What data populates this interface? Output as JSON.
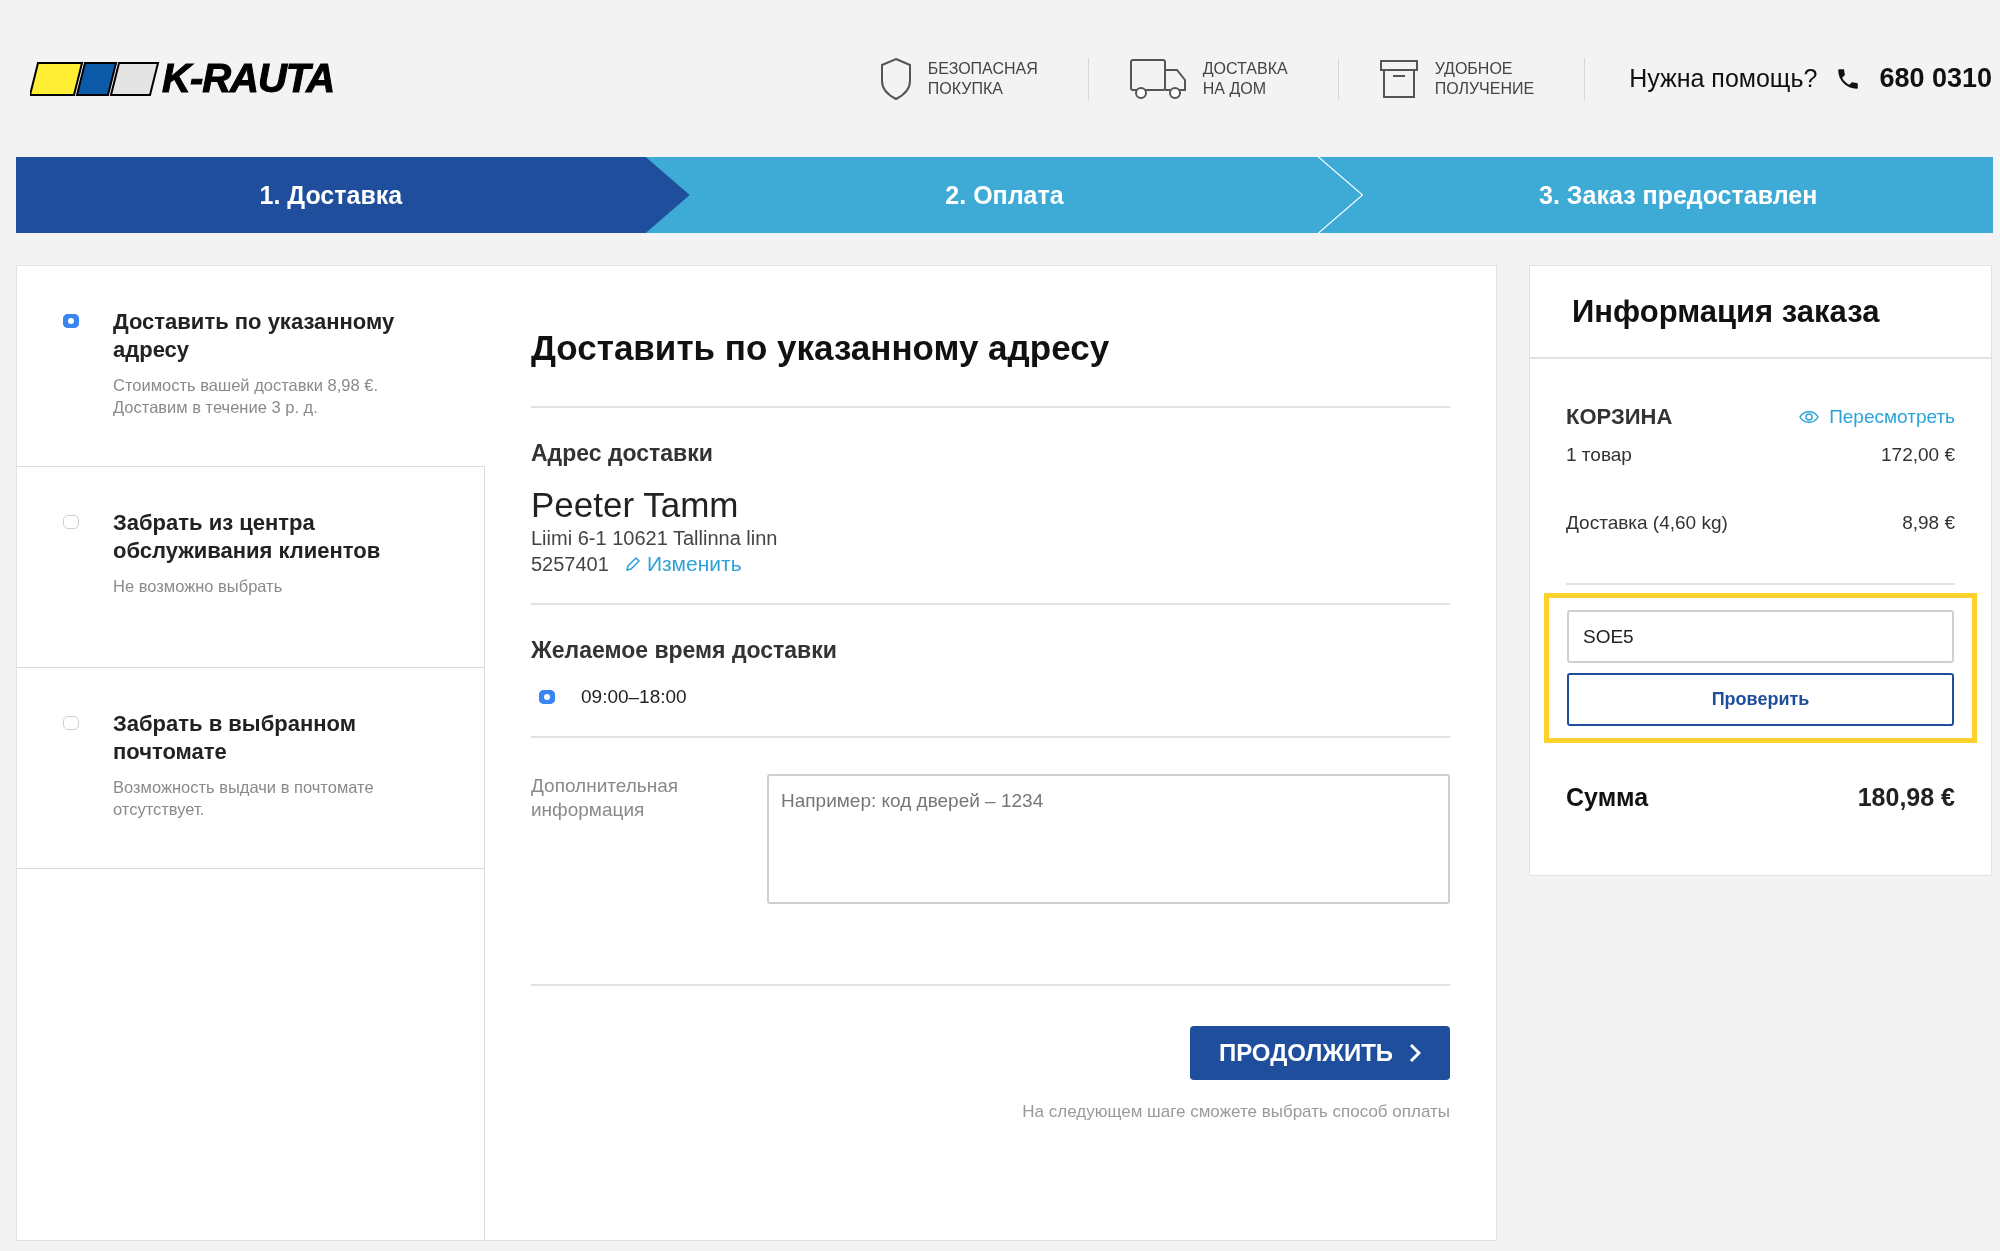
{
  "header": {
    "logo": "K-RAUTA",
    "features": [
      {
        "kind": "shield",
        "lines": [
          "БЕЗОПАСНАЯ",
          "ПОКУПКА"
        ]
      },
      {
        "kind": "truck",
        "lines": [
          "ДОСТАВКА",
          "НА ДОМ"
        ]
      },
      {
        "kind": "box",
        "lines": [
          "УДОБНОЕ",
          "ПОЛУЧЕНИЕ"
        ]
      }
    ],
    "help": "Нужна помощь?",
    "phone": "680 0310"
  },
  "steps": [
    {
      "label": "1. Доставка",
      "selected": true
    },
    {
      "label": "2. Оплата",
      "selected": false
    },
    {
      "label": "3. Заказ предоставлен",
      "selected": false
    }
  ],
  "delivery_options": [
    {
      "title": "Доставить по указанному адресу",
      "description": "Стоимость вашей доставки 8,98 €. Доставим в течение 3 р. д.",
      "selected": true
    },
    {
      "title": "Забрать из центра обслуживания клиентов",
      "description": "Не возможно выбрать",
      "selected": false
    },
    {
      "title": "Забрать в выбранном почтомате",
      "description": "Возможность выдачи в почтомате отсутствует.",
      "selected": false
    }
  ],
  "delivery": {
    "heading": "Доставить по указанному адресу",
    "address": {
      "title": "Адрес доставки",
      "name": "Peeter Tamm",
      "street": "Liimi 6-1 10621 Tallinna linn",
      "phone": "5257401",
      "edit_link": "Изменить"
    },
    "time": {
      "title": "Желаемое время доставки",
      "options": [
        {
          "label": "09:00–18:00",
          "selected": true
        }
      ]
    },
    "notes": {
      "label": "Дополнительная информация",
      "placeholder": "Например: код дверей – 1234"
    },
    "continue_button": "ПРОДОЛЖИТЬ",
    "hint": "На следующем шаге сможете выбрать способ оплаты"
  },
  "order": {
    "title": "Информация заказа",
    "cart_title": "КОРЗИНА",
    "review_link": "Пересмотреть",
    "lines": [
      {
        "label": "1 товар",
        "value": "172,00 €"
      },
      {
        "label": "Доставка (4,60 kg)",
        "value": "8,98 €"
      }
    ],
    "coupon": {
      "value": "SOE5",
      "button": "Проверить",
      "highlighted": true
    },
    "total_label": "Сумма",
    "total_value": "180,98 €"
  }
}
